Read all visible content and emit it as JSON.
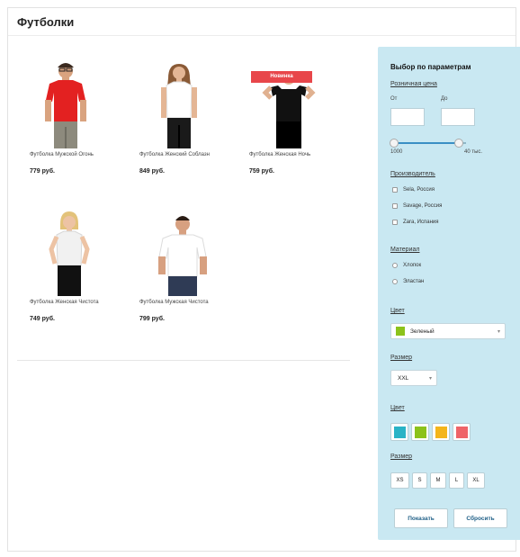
{
  "page": {
    "title": "Футболки"
  },
  "products": [
    {
      "name": "Футболка Мужской Огонь",
      "price": "779 руб.",
      "badge": "",
      "icon": "man-red-tshirt-photo"
    },
    {
      "name": "Футболка Женский Соблазн",
      "price": "849 руб.",
      "badge": "",
      "icon": "woman-white-tshirt-photo"
    },
    {
      "name": "Футболка Женская Ночь",
      "price": "759 руб.",
      "badge": "Новинка",
      "icon": "woman-black-tshirt-photo"
    },
    {
      "name": "Футболка Женская Чистота",
      "price": "749 руб.",
      "badge": "",
      "icon": "woman-grey-tshirt-photo"
    },
    {
      "name": "Футболка Мужская Чистота",
      "price": "799 руб.",
      "badge": "",
      "icon": "man-white-tshirt-photo"
    }
  ],
  "filter": {
    "title": "Выбор по параметрам",
    "price": {
      "label": "Розничная цена",
      "from_label": "От",
      "to_label": "До",
      "from_value": "",
      "to_value": "",
      "min_label": "1000",
      "max_label": "40 тыс.",
      "range_low_fraction": 0.0,
      "range_high_fraction": 0.9
    },
    "manufacturer": {
      "label": "Производитель",
      "options": [
        "Sela, Россия",
        "Savage, Россия",
        "Zara, Испания"
      ]
    },
    "material": {
      "label": "Материал",
      "options": [
        "Хлопок",
        "Эластан"
      ]
    },
    "color_select": {
      "label": "Цвет",
      "value": "Зеленый",
      "swatch": "#8cc21a"
    },
    "size_select": {
      "label": "Размер",
      "value": "XXL"
    },
    "color_swatches": {
      "label": "Цвет",
      "colors": [
        "#2ab3c6",
        "#8cc21a",
        "#f4b51b",
        "#ef6468"
      ]
    },
    "size_buttons": {
      "label": "Размер",
      "sizes": [
        "XS",
        "S",
        "M",
        "L",
        "XL"
      ]
    },
    "show_button": "Показать",
    "reset_button": "Сбросить"
  },
  "colors": {
    "panel": "#c9e8f2",
    "badge": "#e8464a",
    "accent": "#3a8fc4"
  }
}
